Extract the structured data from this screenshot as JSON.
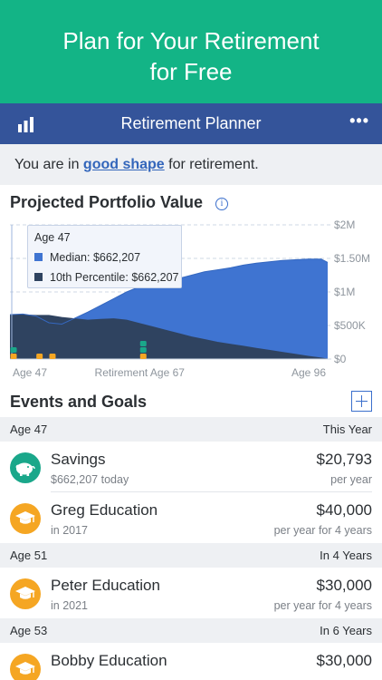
{
  "promo": {
    "line1": "Plan for Your Retirement",
    "line2": "for Free"
  },
  "navbar": {
    "title": "Retirement Planner",
    "more_label": "•••",
    "left_icon": "bar-chart-icon"
  },
  "status": {
    "prefix": "You are in ",
    "link": "good shape",
    "suffix": " for retirement."
  },
  "chart": {
    "title": "Projected Portfolio Value",
    "info_icon": "info-icon",
    "tooltip": {
      "age": "Age 47",
      "median_label": "Median: $662,207",
      "p10_label": "10th Percentile: $662,207"
    },
    "colors": {
      "median": "#3f74d1",
      "p10": "#34495e",
      "events_orange": "#f5a623",
      "events_green": "#1aa78a"
    }
  },
  "chart_data": {
    "type": "area",
    "title": "Projected Portfolio Value",
    "x_tick_labels": [
      "Age 47",
      "Retirement Age 67",
      "Age 96"
    ],
    "y_tick_labels": [
      "$2M",
      "$1.50M",
      "$1M",
      "$500K",
      "$0"
    ],
    "ylim": [
      0,
      2000000
    ],
    "x": [
      47,
      49,
      51,
      53,
      55,
      57,
      59,
      61,
      63,
      65,
      67,
      69,
      71,
      73,
      75,
      77,
      79,
      81,
      83,
      85,
      87,
      89,
      91,
      93,
      95,
      96
    ],
    "series": [
      {
        "name": "Median",
        "values": [
          662207,
          670000,
          640000,
          540000,
          520000,
          610000,
          700000,
          800000,
          900000,
          1000000,
          1080000,
          1120000,
          1160000,
          1200000,
          1250000,
          1300000,
          1330000,
          1360000,
          1400000,
          1430000,
          1450000,
          1470000,
          1480000,
          1490000,
          1490000,
          1440000
        ]
      },
      {
        "name": "10th Percentile",
        "values": [
          662207,
          660000,
          650000,
          650000,
          620000,
          600000,
          580000,
          590000,
          600000,
          580000,
          530000,
          480000,
          430000,
          380000,
          330000,
          290000,
          250000,
          220000,
          190000,
          160000,
          130000,
          100000,
          70000,
          40000,
          15000,
          0
        ]
      }
    ],
    "event_markers": [
      {
        "age": 47,
        "color": "orange"
      },
      {
        "age": 47,
        "color": "green"
      },
      {
        "age": 51,
        "color": "orange"
      },
      {
        "age": 53,
        "color": "orange"
      },
      {
        "age": 67,
        "color": "orange"
      },
      {
        "age": 67,
        "color": "green"
      },
      {
        "age": 67,
        "color": "green"
      }
    ],
    "grid": true,
    "legend": "tooltip"
  },
  "events": {
    "title": "Events and Goals",
    "add_icon": "plus-icon",
    "groups": [
      {
        "left": "Age 47",
        "right": "This Year",
        "items": [
          {
            "name": "Savings",
            "sub": "$662,207 today",
            "amount": "$20,793",
            "freq": "per year",
            "icon": "piggy-bank-icon"
          },
          {
            "name": "Greg Education",
            "sub": "in 2017",
            "amount": "$40,000",
            "freq": "per year for 4 years",
            "icon": "graduation-cap-icon"
          }
        ]
      },
      {
        "left": "Age 51",
        "right": "In 4 Years",
        "items": [
          {
            "name": "Peter Education",
            "sub": "in 2021",
            "amount": "$30,000",
            "freq": "per year for 4 years",
            "icon": "graduation-cap-icon"
          }
        ]
      },
      {
        "left": "Age 53",
        "right": "In 6 Years",
        "items": [
          {
            "name": "Bobby Education",
            "sub": "",
            "amount": "$30,000",
            "freq": "",
            "icon": "graduation-cap-icon"
          }
        ]
      }
    ]
  }
}
